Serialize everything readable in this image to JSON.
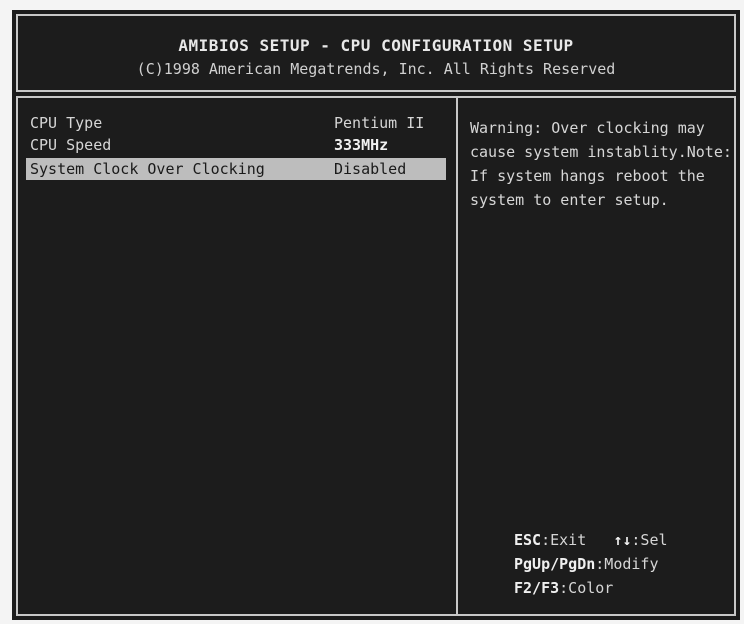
{
  "header": {
    "title": "AMIBIOS SETUP - CPU CONFIGURATION SETUP",
    "copyright": "(C)1998 American Megatrends, Inc. All Rights Reserved"
  },
  "settings": [
    {
      "label": "CPU Type",
      "value": "Pentium II"
    },
    {
      "label": "CPU Speed",
      "value": "333MHz"
    },
    {
      "label": "System Clock Over Clocking",
      "value": "Disabled"
    }
  ],
  "help": {
    "lines": [
      "Warning: Over clocking may",
      "cause system instablity.Note:",
      "If system hangs reboot the",
      "system to enter setup."
    ]
  },
  "keys": [
    {
      "key": "ESC",
      "action": ":Exit",
      "key2": "↑↓",
      "action2": ":Sel"
    },
    {
      "key": "PgUp/PgDn",
      "action": ":Modify"
    },
    {
      "key": "F2/F3",
      "action": ":Color"
    }
  ],
  "colors": {
    "background": "#1c1c1c",
    "text": "#d6d6d6",
    "highlight": "#bdbdbd",
    "border": "#c8c8c8"
  }
}
